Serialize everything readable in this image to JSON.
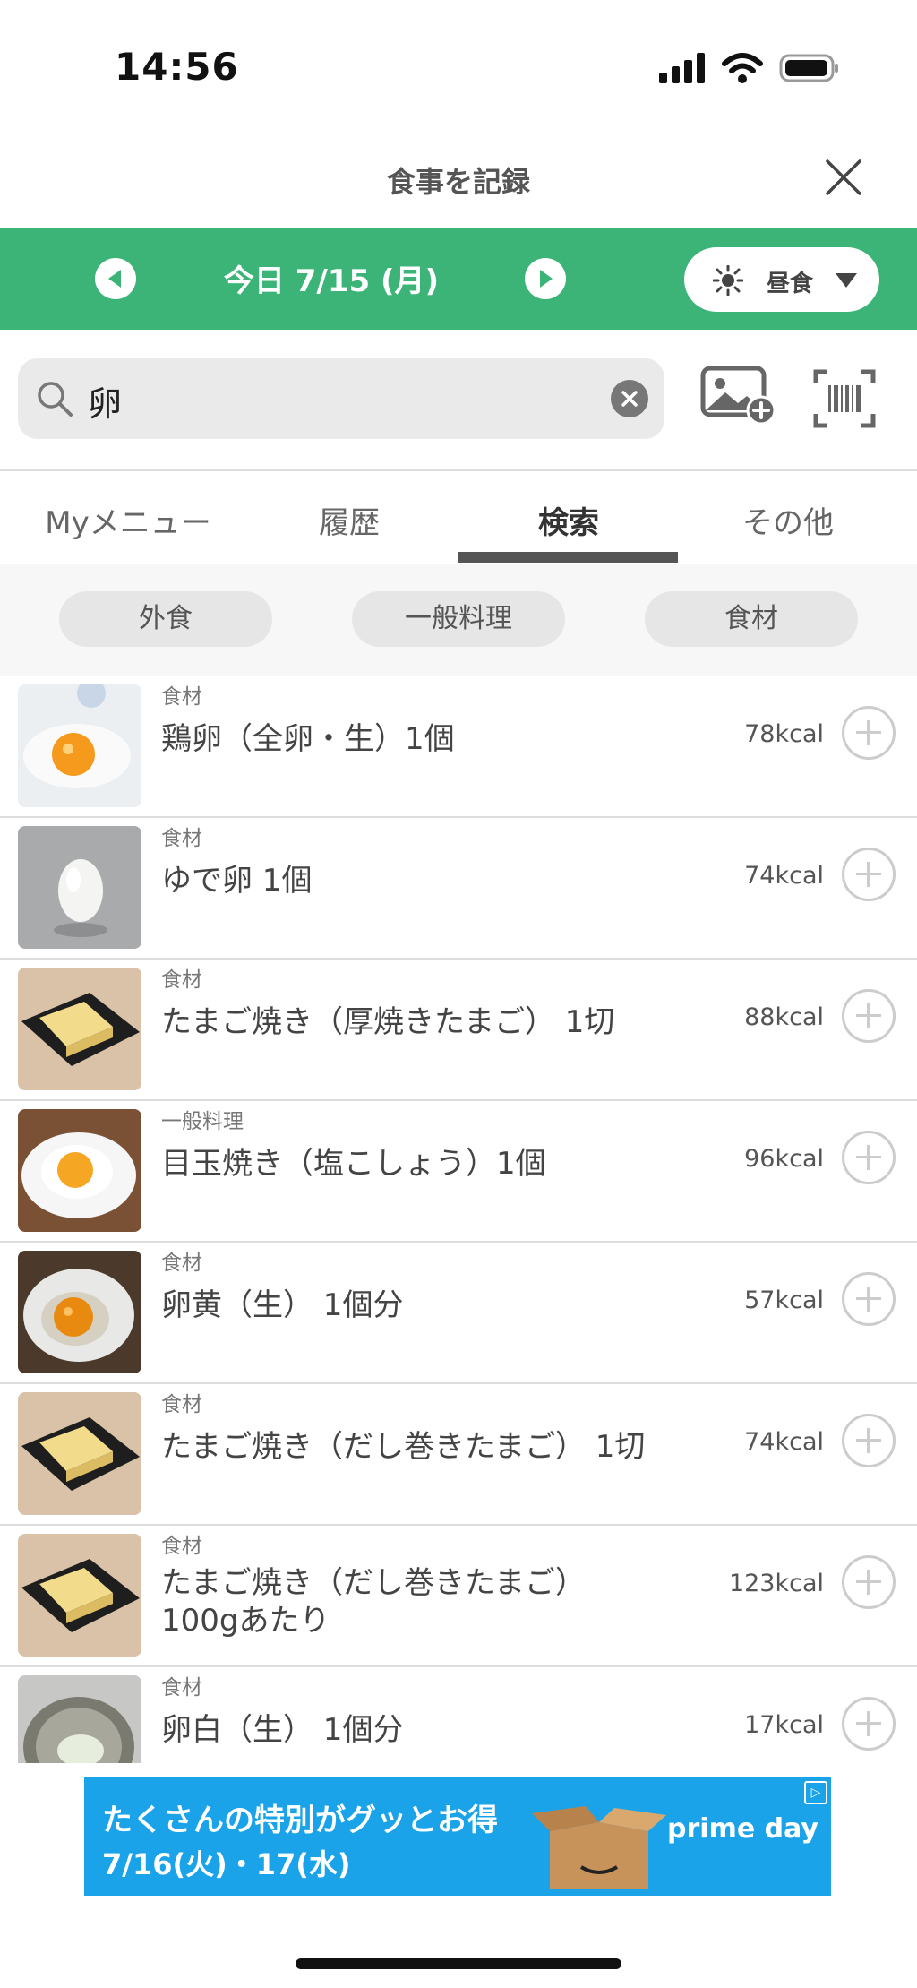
{
  "status": {
    "time": "14:56"
  },
  "header": {
    "title": "食事を記録"
  },
  "date_bar": {
    "date": "今日 7/15 (月)",
    "meal_label": "昼食"
  },
  "search": {
    "value": "卵"
  },
  "tabs": [
    {
      "label": "Myメニュー"
    },
    {
      "label": "履歴"
    },
    {
      "label": "検索",
      "active": true
    },
    {
      "label": "その他"
    }
  ],
  "chips": [
    {
      "label": "外食"
    },
    {
      "label": "一般料理"
    },
    {
      "label": "食材"
    }
  ],
  "results": [
    {
      "category": "食材",
      "name": "鶏卵（全卵・生）1個",
      "kcal": "78kcal",
      "thumb": "raw-egg"
    },
    {
      "category": "食材",
      "name": "ゆで卵 1個",
      "kcal": "74kcal",
      "thumb": "boiled-egg"
    },
    {
      "category": "食材",
      "name": "たまご焼き（厚焼きたまご） 1切",
      "kcal": "88kcal",
      "thumb": "tamagoyaki"
    },
    {
      "category": "一般料理",
      "name": "目玉焼き（塩こしょう）1個",
      "kcal": "96kcal",
      "thumb": "fried-egg"
    },
    {
      "category": "食材",
      "name": "卵黄（生） 1個分",
      "kcal": "57kcal",
      "thumb": "egg-yolk"
    },
    {
      "category": "食材",
      "name": "たまご焼き（だし巻きたまご） 1切",
      "kcal": "74kcal",
      "thumb": "tamagoyaki"
    },
    {
      "category": "食材",
      "name_line1": "たまご焼き（だし巻きたまご）",
      "name_line2": "100gあたり",
      "kcal": "123kcal",
      "thumb": "tamagoyaki"
    },
    {
      "category": "食材",
      "name": "卵白（生） 1個分",
      "kcal": "17kcal",
      "thumb": "egg-white"
    }
  ],
  "ad": {
    "line1": "たくさんの特別がグッとお得",
    "line2": "7/16(火)・17(水)",
    "brand": "prime day"
  },
  "colors": {
    "accent": "#3db477",
    "ad_bg": "#1aa3e8"
  }
}
